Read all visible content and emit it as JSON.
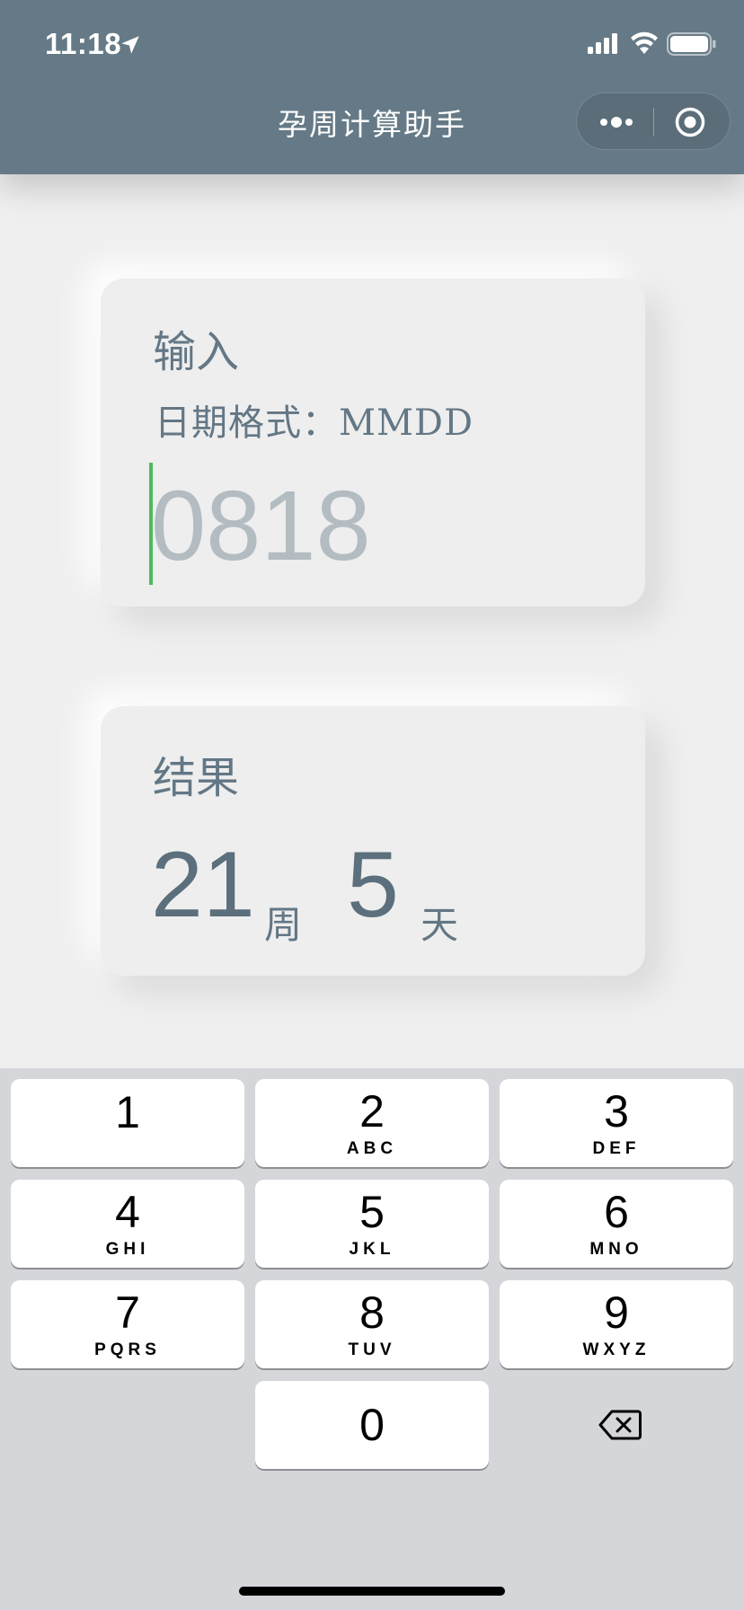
{
  "status_bar": {
    "time": "11:18"
  },
  "nav": {
    "title": "孕周计算助手"
  },
  "input_card": {
    "title": "输入",
    "format_hint": "日期格式：MMDD",
    "placeholder": "0818",
    "value": ""
  },
  "result_card": {
    "title": "结果",
    "weeks": "21",
    "weeks_unit": "周",
    "days": "5",
    "days_unit": "天"
  },
  "keypad": {
    "keys": [
      {
        "num": "1",
        "letters": ""
      },
      {
        "num": "2",
        "letters": "ABC"
      },
      {
        "num": "3",
        "letters": "DEF"
      },
      {
        "num": "4",
        "letters": "GHI"
      },
      {
        "num": "5",
        "letters": "JKL"
      },
      {
        "num": "6",
        "letters": "MNO"
      },
      {
        "num": "7",
        "letters": "PQRS"
      },
      {
        "num": "8",
        "letters": "TUV"
      },
      {
        "num": "9",
        "letters": "WXYZ"
      },
      {
        "num": "0",
        "letters": ""
      }
    ]
  },
  "colors": {
    "header": "#657a86",
    "text": "#637785",
    "caret": "#4cbb5c",
    "background": "#efefef",
    "keyboard": "#d4d6da"
  },
  "icons": [
    "location-arrow-icon",
    "cellular-signal-icon",
    "wifi-icon",
    "battery-icon",
    "more-dots-icon",
    "close-target-icon",
    "backspace-icon"
  ]
}
